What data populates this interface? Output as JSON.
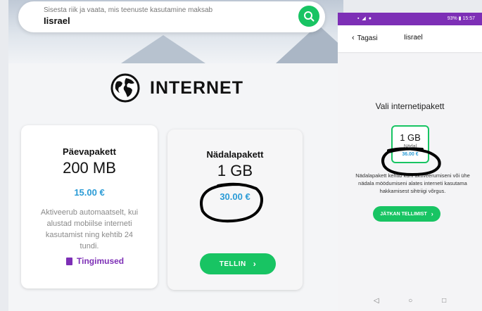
{
  "search": {
    "hint": "Sisesta riik ja vaata, mis teenuste kasutamine maksab",
    "value": "Iisrael"
  },
  "section": {
    "title": "INTERNET"
  },
  "packages": [
    {
      "name": "Päevapakett",
      "size": "200 MB",
      "price": "15.00 €",
      "description": "Aktiveerub automaatselt, kui alustad mobiilse interneti kasutamist ning kehtib 24 tundi.",
      "terms_label": "Tingimused"
    },
    {
      "name": "Nädalapakett",
      "size": "1 GB",
      "price": "30.00 €",
      "order_label": "TELLIN"
    }
  ],
  "phone": {
    "status_right": "93% ▮ 15:57",
    "back_label": "Tagasi",
    "title": "Iisrael",
    "heading": "Vali internetipakett",
    "card": {
      "size": "1 GB",
      "name": "Nädal",
      "price": "36.00 €"
    },
    "description": "Nädalapakett kehtib kuni aktiveerumiseni või ühe nädala möödumiseni alates interneti kasutama hakkamisest sihtriigi võrgus.",
    "continue_label": "JÄTKAN TELLIMIST"
  },
  "colors": {
    "accent_green": "#18c463",
    "price_blue": "#2a9bd6",
    "brand_purple": "#7d2fb6"
  }
}
